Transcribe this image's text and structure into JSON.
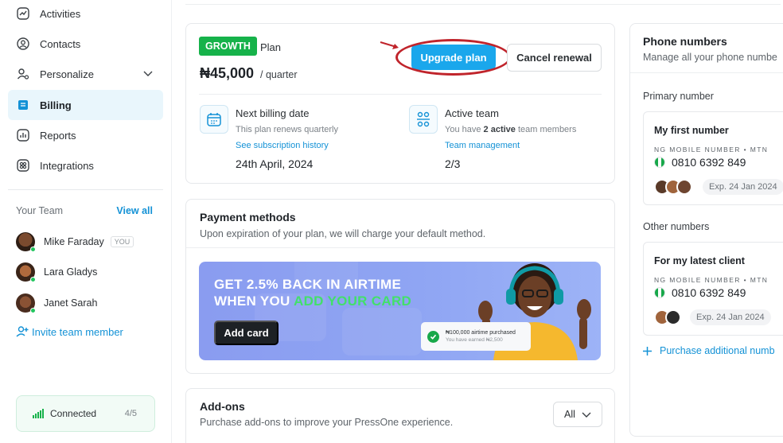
{
  "sidebar": {
    "items": [
      {
        "label": "Activities",
        "icon": "activity-icon"
      },
      {
        "label": "Contacts",
        "icon": "contacts-icon"
      },
      {
        "label": "Personalize",
        "icon": "personalize-icon"
      },
      {
        "label": "Billing",
        "icon": "billing-icon"
      },
      {
        "label": "Reports",
        "icon": "reports-icon"
      },
      {
        "label": "Integrations",
        "icon": "integrations-icon"
      }
    ],
    "team": {
      "title": "Your Team",
      "view_all": "View all",
      "members": [
        {
          "name": "Mike Faraday",
          "badge": "YOU"
        },
        {
          "name": "Lara Gladys"
        },
        {
          "name": "Janet Sarah"
        }
      ],
      "invite": "Invite team member"
    },
    "connection": {
      "status": "Connected",
      "count": "4/5"
    }
  },
  "plan": {
    "badge": "GROWTH",
    "label": "Plan",
    "price": "₦45,000",
    "period": "/ quarter",
    "upgrade": "Upgrade plan",
    "cancel": "Cancel renewal",
    "billing": {
      "title": "Next billing date",
      "sub": "This plan renews quarterly",
      "link": "See subscription history",
      "value": "24th April, 2024"
    },
    "team": {
      "title": "Active team",
      "sub_pre": "You have",
      "sub_bold": "2 active",
      "sub_post": "team members",
      "link": "Team management",
      "value": "2/3"
    }
  },
  "payment": {
    "title": "Payment methods",
    "subtitle": "Upon expiration of your plan, we will charge your default method.",
    "banner": {
      "line1": "GET 2.5% BACK IN AIRTIME",
      "line2_pre": "WHEN YOU",
      "line2_highlight": "ADD YOUR CARD",
      "button": "Add card",
      "toast_line1": "₦100,000 airtime purchased",
      "toast_line2": "You have earned ₦2,500"
    }
  },
  "addons": {
    "title": "Add-ons",
    "subtitle": "Purchase add-ons to improve your PressOne experience.",
    "filter": "All"
  },
  "phones": {
    "title": "Phone numbers",
    "subtitle": "Manage all your phone numbe",
    "primary_label": "Primary number",
    "primary": {
      "name": "My first number",
      "type": "NG MOBILE NUMBER • MTN",
      "number": "0810 6392 849",
      "expiry": "Exp. 24 Jan 2024"
    },
    "other_label": "Other numbers",
    "other": {
      "name": "For my latest client",
      "type": "NG MOBILE NUMBER • MTN",
      "number": "0810 6392 849",
      "expiry": "Exp. 24 Jan 2024"
    },
    "purchase": "Purchase additional numb"
  },
  "colors": {
    "accent": "#1aa7ec",
    "growth": "#16b24a",
    "highlight": "#c0242b"
  }
}
